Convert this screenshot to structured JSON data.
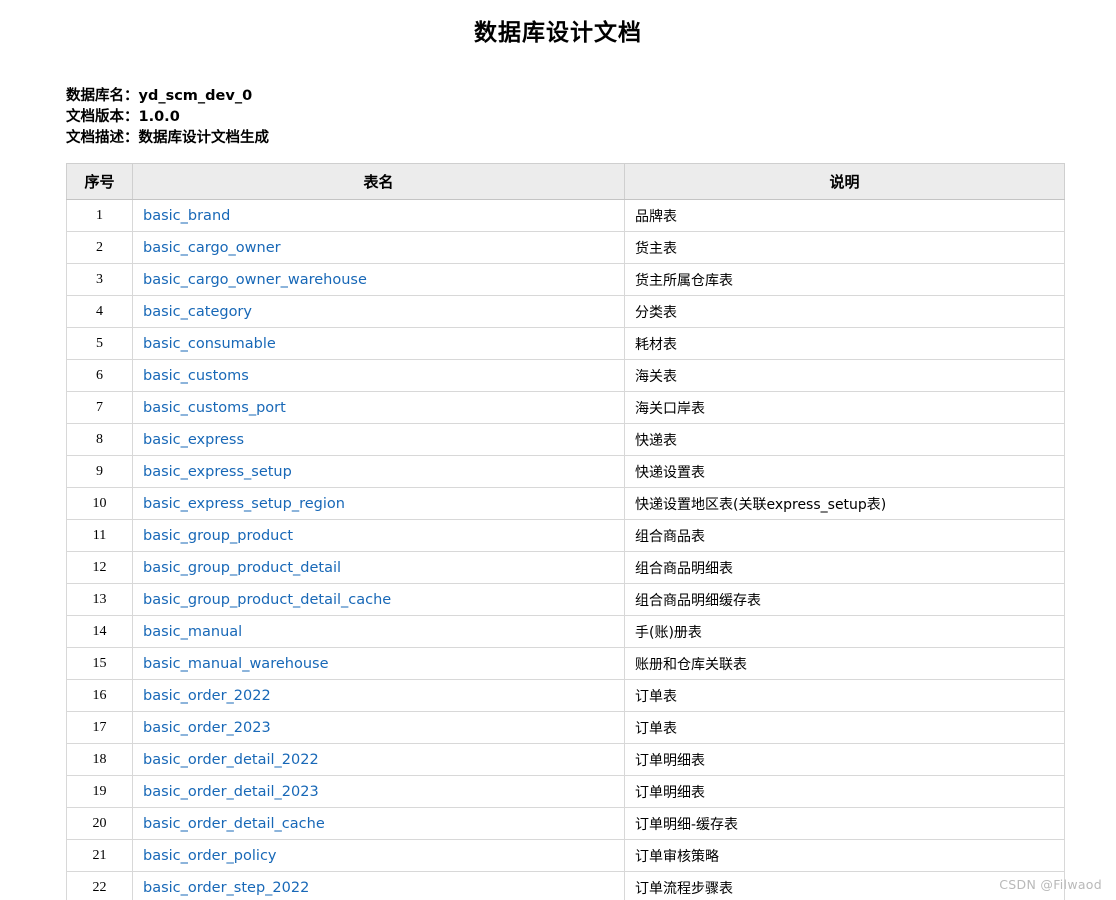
{
  "document": {
    "title": "数据库设计文档"
  },
  "meta": {
    "db_label": "数据库名：",
    "db_value": "yd_scm_dev_0",
    "version_label": "文档版本：",
    "version_value": "1.0.0",
    "desc_label": "文档描述：",
    "desc_value": "数据库设计文档生成"
  },
  "table": {
    "headers": {
      "index": "序号",
      "name": "表名",
      "description": "说明"
    },
    "rows": [
      {
        "index": "1",
        "name": "basic_brand",
        "description": "品牌表"
      },
      {
        "index": "2",
        "name": "basic_cargo_owner",
        "description": "货主表"
      },
      {
        "index": "3",
        "name": "basic_cargo_owner_warehouse",
        "description": "货主所属仓库表"
      },
      {
        "index": "4",
        "name": "basic_category",
        "description": "分类表"
      },
      {
        "index": "5",
        "name": "basic_consumable",
        "description": "耗材表"
      },
      {
        "index": "6",
        "name": "basic_customs",
        "description": "海关表"
      },
      {
        "index": "7",
        "name": "basic_customs_port",
        "description": "海关口岸表"
      },
      {
        "index": "8",
        "name": "basic_express",
        "description": "快递表"
      },
      {
        "index": "9",
        "name": "basic_express_setup",
        "description": "快递设置表"
      },
      {
        "index": "10",
        "name": "basic_express_setup_region",
        "description": "快递设置地区表(关联express_setup表)"
      },
      {
        "index": "11",
        "name": "basic_group_product",
        "description": "组合商品表"
      },
      {
        "index": "12",
        "name": "basic_group_product_detail",
        "description": "组合商品明细表"
      },
      {
        "index": "13",
        "name": "basic_group_product_detail_cache",
        "description": "组合商品明细缓存表"
      },
      {
        "index": "14",
        "name": "basic_manual",
        "description": "手(账)册表"
      },
      {
        "index": "15",
        "name": "basic_manual_warehouse",
        "description": "账册和仓库关联表"
      },
      {
        "index": "16",
        "name": "basic_order_2022",
        "description": "订单表"
      },
      {
        "index": "17",
        "name": "basic_order_2023",
        "description": "订单表"
      },
      {
        "index": "18",
        "name": "basic_order_detail_2022",
        "description": "订单明细表"
      },
      {
        "index": "19",
        "name": "basic_order_detail_2023",
        "description": "订单明细表"
      },
      {
        "index": "20",
        "name": "basic_order_detail_cache",
        "description": "订单明细-缓存表"
      },
      {
        "index": "21",
        "name": "basic_order_policy",
        "description": "订单审核策略"
      },
      {
        "index": "22",
        "name": "basic_order_step_2022",
        "description": "订单流程步骤表"
      }
    ]
  },
  "watermark": {
    "text": "CSDN @Filwaod"
  },
  "colors": {
    "link": "#1868b7",
    "header_bg": "#ececec",
    "border": "#d8d8d8",
    "watermark": "#b9b9b9"
  }
}
